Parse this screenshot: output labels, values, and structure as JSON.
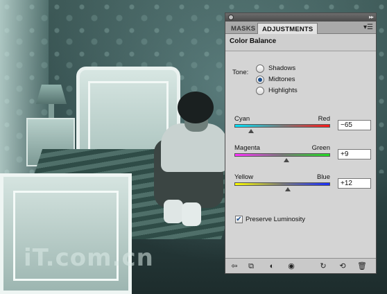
{
  "panel": {
    "tabs": [
      {
        "label": "MASKS"
      },
      {
        "label": "ADJUSTMENTS"
      }
    ],
    "title": "Color Balance",
    "tone": {
      "label": "Tone:",
      "options": [
        "Shadows",
        "Midtones",
        "Highlights"
      ],
      "selected": "Midtones"
    },
    "sliders": [
      {
        "left": "Cyan",
        "right": "Red",
        "value": "−65",
        "level": -65
      },
      {
        "left": "Magenta",
        "right": "Green",
        "value": "+9",
        "level": 9
      },
      {
        "left": "Yellow",
        "right": "Blue",
        "value": "+12",
        "level": 12
      }
    ],
    "preserve_luminosity": {
      "label": "Preserve Luminosity",
      "checked": true
    },
    "footer_icons": [
      "back-arrow-icon",
      "clip-to-layer-icon",
      "mask-toggle-icon",
      "eye-icon",
      "previous-state-icon",
      "reset-icon",
      "trash-icon"
    ]
  },
  "watermark": "iT.com.cn",
  "colors": {
    "panel_bg": "#d4d4d4",
    "cyan_red": [
      "#00e5ff",
      "#ff1a1a"
    ],
    "magenta_green": [
      "#ff33ff",
      "#22dd22"
    ],
    "yellow_blue": [
      "#ffff00",
      "#1a2fff"
    ]
  }
}
